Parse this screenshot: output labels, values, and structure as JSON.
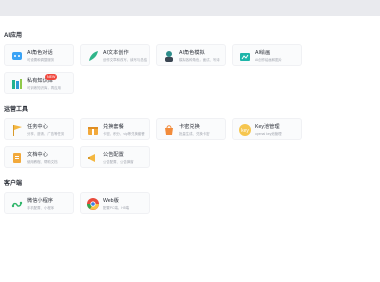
{
  "sections": [
    {
      "title": "AI应用",
      "cards": [
        {
          "title": "AI角色对话",
          "desc": "可设置和调整服务",
          "icon": "robot-chat-icon"
        },
        {
          "title": "AI文本创作",
          "desc": "创作文章和改写、续写与总结",
          "icon": "feather-pen-icon"
        },
        {
          "title": "AI角色模拟",
          "desc": "模拟各种角色，面试、写诗",
          "icon": "costume-character-icon"
        },
        {
          "title": "AI绘画",
          "desc": "AI创作绘画和图片",
          "icon": "painting-icon"
        },
        {
          "title": "私有知识库",
          "desc": "可训练知识库，再应用",
          "icon": "book-stack-icon",
          "badge": "NEW"
        }
      ]
    },
    {
      "title": "运营工具",
      "cards": [
        {
          "title": "任务中心",
          "desc": "分享、邀请、广告等任务",
          "icon": "flag-icon"
        },
        {
          "title": "兑换套餐",
          "desc": "卡密、积分、vip等兑换套餐",
          "icon": "gift-box-icon"
        },
        {
          "title": "卡密兑换",
          "desc": "批量生成、兑换卡密",
          "icon": "gift-bag-icon"
        },
        {
          "title": "Key池管理",
          "desc": "openai key池管理",
          "icon": "key-icon"
        },
        {
          "title": "文档中心",
          "desc": "使用教程、帮助文档",
          "icon": "document-icon"
        },
        {
          "title": "公告配置",
          "desc": "公告配置、公告弹窗",
          "icon": "megaphone-icon"
        }
      ]
    },
    {
      "title": "客户端",
      "cards": [
        {
          "title": "微信小程序",
          "desc": "手机配置、小程序",
          "icon": "mini-program-icon"
        },
        {
          "title": "Web版",
          "desc": "配置PC端、H5端",
          "icon": "chrome-icon"
        }
      ]
    }
  ]
}
